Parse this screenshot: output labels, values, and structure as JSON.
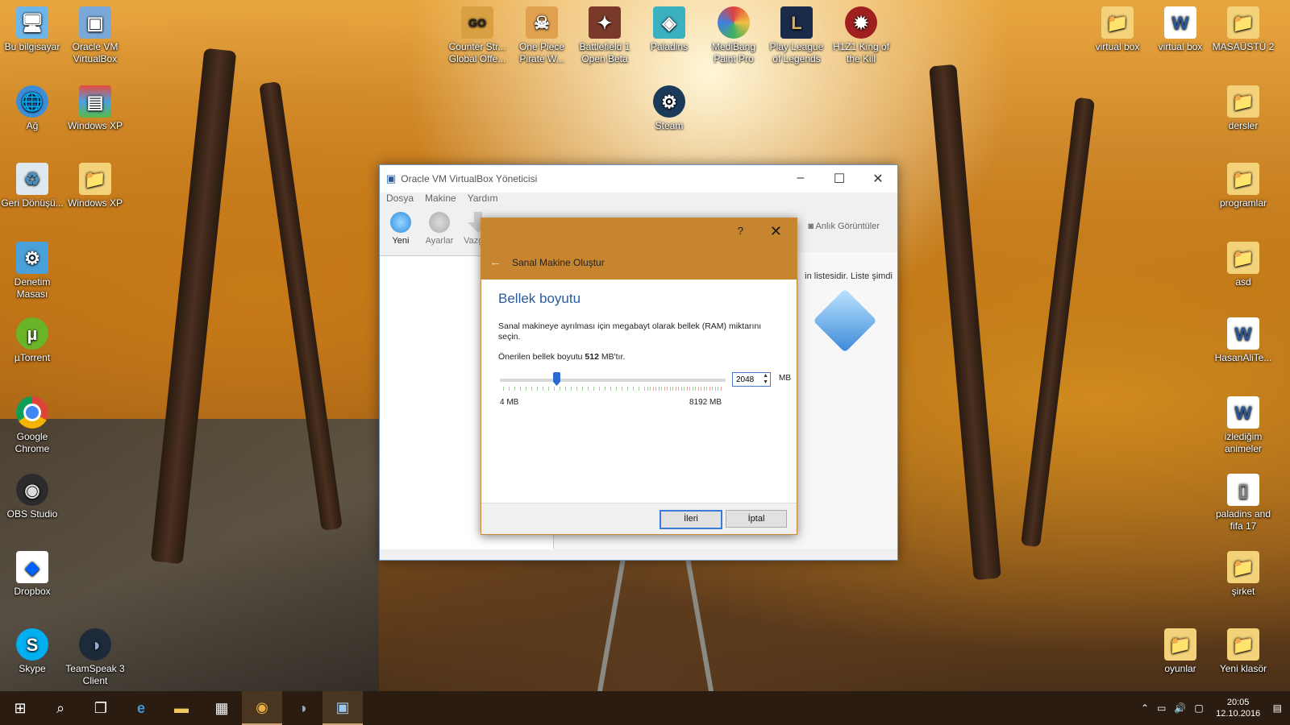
{
  "desktop": {
    "left_icons": [
      {
        "label": "Bu bilgisayar"
      },
      {
        "label": "Ağ"
      },
      {
        "label": "Geri Dönüşü..."
      },
      {
        "label": "Denetim Masası"
      },
      {
        "label": "µTorrent"
      },
      {
        "label": "Google Chrome"
      },
      {
        "label": "OBS Studio"
      },
      {
        "label": "Dropbox"
      },
      {
        "label": "Skype"
      }
    ],
    "second_column_icons": [
      {
        "label": "Oracle VM VirtualBox"
      },
      {
        "label": "Windows XP"
      },
      {
        "label": "Windows XP"
      },
      {
        "label": "TeamSpeak 3 Client"
      }
    ],
    "top_icons": [
      {
        "label": "Counter Str... Global Offe..."
      },
      {
        "label": "One Piece Pirate W..."
      },
      {
        "label": "Battlefield 1 Open Beta"
      },
      {
        "label": "Paladins"
      },
      {
        "label": "MediBang Paint Pro"
      },
      {
        "label": "Play League of Legends"
      },
      {
        "label": "H1Z1 King of the Kill"
      }
    ],
    "steam_icon": {
      "label": "Steam"
    },
    "right_top_icons": [
      {
        "label": "virtual box"
      },
      {
        "label": "virtual box"
      },
      {
        "label": "MASAÜSTÜ 2"
      }
    ],
    "right_icons": [
      {
        "label": "dersler"
      },
      {
        "label": "programlar"
      },
      {
        "label": "asd"
      },
      {
        "label": "HasanAliTe..."
      },
      {
        "label": "izlediğim animeler"
      },
      {
        "label": "paladins and fifa 17"
      },
      {
        "label": "şirket"
      }
    ],
    "bottom_right_icons": [
      {
        "label": "oyunlar"
      },
      {
        "label": "Yeni klasör"
      }
    ]
  },
  "vbox_window": {
    "title": "Oracle VM VirtualBox Yöneticisi",
    "menu": [
      "Dosya",
      "Makine",
      "Yardım"
    ],
    "toolbar": [
      "Yeni",
      "Ayarlar",
      "Vazgeç"
    ],
    "snapshots_label": "Anlık Görüntüler",
    "welcome_text": "in listesidir. Liste şimdi"
  },
  "dialog": {
    "title": "Sanal Makine Oluştur",
    "help": "?",
    "heading": "Bellek boyutu",
    "description": "Sanal makineye ayrılması için megabayt olarak bellek (RAM) miktarını seçin.",
    "recommended_prefix": "Önerilen bellek boyutu",
    "recommended_value": "512",
    "recommended_suffix": "MB'tır.",
    "memory_value": "2048",
    "memory_fraction": 0.25,
    "unit": "MB",
    "min_label": "4 MB",
    "max_label": "8192 MB",
    "next_button": "İleri",
    "cancel_button": "İptal"
  },
  "taskbar": {
    "time": "20:05",
    "date": "12.10.2016"
  }
}
